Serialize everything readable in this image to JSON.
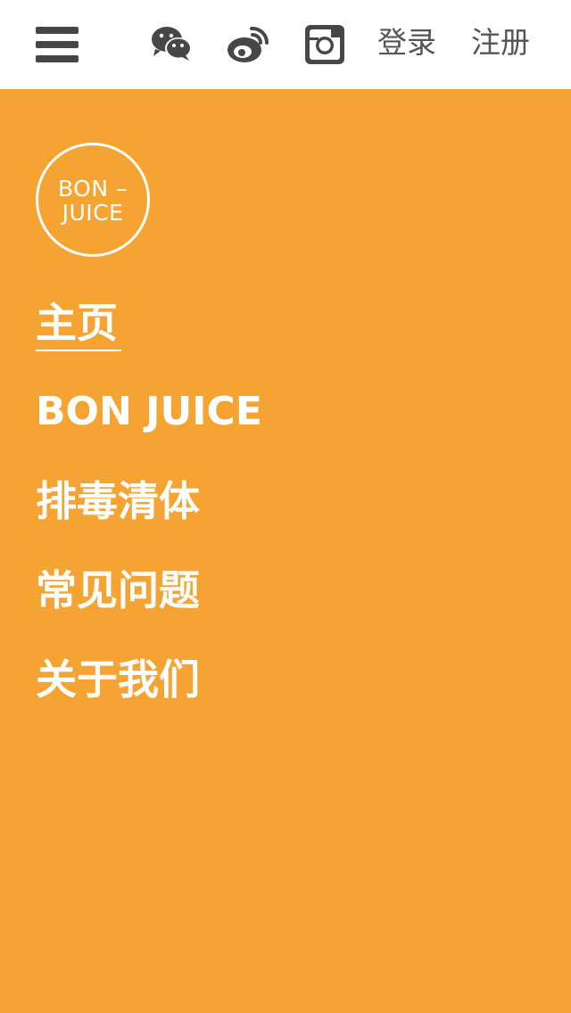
{
  "header": {
    "menu_icon": "hamburger-menu-icon",
    "social_icons": [
      "wechat-icon",
      "weibo-icon",
      "instagram-icon"
    ],
    "login_label": "登录",
    "register_label": "注册"
  },
  "logo": {
    "line1": "BON –",
    "line2": "JUICE"
  },
  "nav": {
    "items": [
      {
        "label": "主页",
        "active": true
      },
      {
        "label": "BON JUICE",
        "active": false
      },
      {
        "label": "排毒清体",
        "active": false
      },
      {
        "label": "常见问题",
        "active": false
      },
      {
        "label": "关于我们",
        "active": false
      }
    ]
  },
  "colors": {
    "background": "#f5a333",
    "header_bg": "#ffffff",
    "icon_gray": "#474747",
    "text_white": "#ffffff"
  }
}
